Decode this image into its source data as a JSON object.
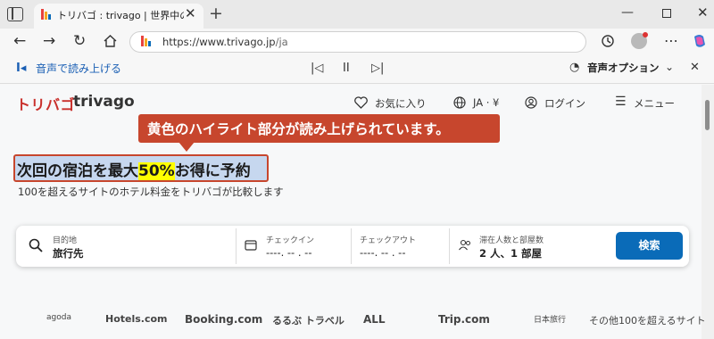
{
  "browser": {
    "tab_title": "トリバゴ : trivago | 世界中のホテル料",
    "address_url": "https://www.trivago.jp/ja",
    "address_host": "https://www.trivago.jp",
    "address_path": "/ja"
  },
  "read_aloud": {
    "label": "音声で読み上げる",
    "options_label": "音声オプション"
  },
  "site": {
    "logo_jp": "トリバゴ",
    "logo_en": "trivago",
    "nav": {
      "favorites": "お気に入り",
      "locale": "JA · ¥",
      "login": "ログイン",
      "menu": "メニュー"
    },
    "tooltip": "黄色のハイライト部分が読み上げられています。",
    "headline_pre": "次回の宿泊を最大",
    "headline_highlight": "50%",
    "headline_post": "お得に予約",
    "subline": "100を超えるサイトのホテル料金をトリバゴが比較します"
  },
  "search": {
    "destination_label": "目的地",
    "destination_value": "旅行先",
    "checkin_label": "チェックイン",
    "checkin_value": "----. -- . --",
    "checkout_label": "チェックアウト",
    "checkout_value": "----. -- . --",
    "guests_label": "滞在人数と部屋数",
    "guests_value": "2 人、1 部屋",
    "button": "検索"
  },
  "partners": [
    "agoda",
    "Hotels.com",
    "Booking.com",
    "るるぶ トラベル",
    "ALL",
    "Trip.com",
    "日本旅行",
    "その他100を超えるサイト"
  ],
  "colors": {
    "accent_red": "#c7462d",
    "brand_blue": "#0a6bb8",
    "highlight_yellow": "#ffff00"
  }
}
